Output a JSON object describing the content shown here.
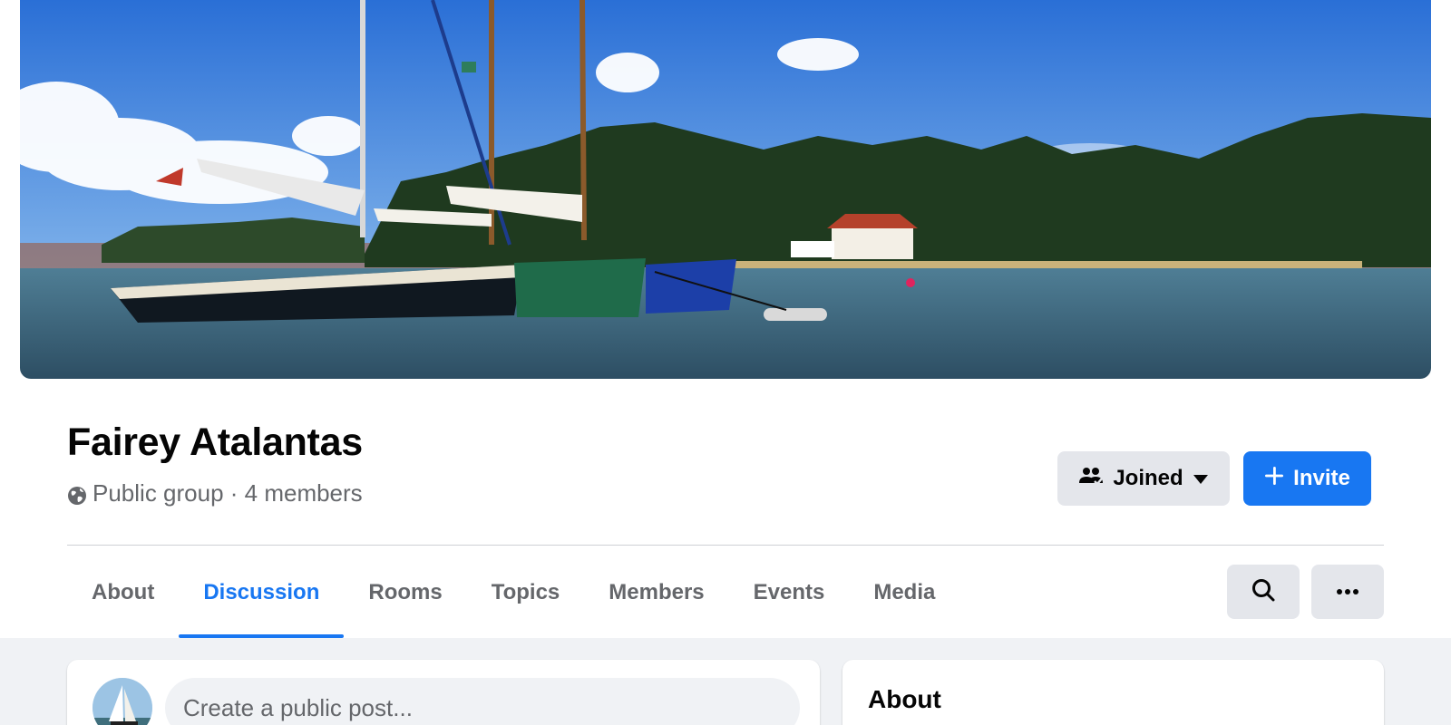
{
  "group": {
    "title": "Fairey Atalantas",
    "meta": "Public group · 4 members"
  },
  "actions": {
    "joined_label": "Joined",
    "invite_label": "Invite"
  },
  "tabs": [
    {
      "label": "About",
      "active": false
    },
    {
      "label": "Discussion",
      "active": true
    },
    {
      "label": "Rooms",
      "active": false
    },
    {
      "label": "Topics",
      "active": false
    },
    {
      "label": "Members",
      "active": false
    },
    {
      "label": "Events",
      "active": false
    },
    {
      "label": "Media",
      "active": false
    }
  ],
  "composer": {
    "placeholder": "Create a public post..."
  },
  "sidebar": {
    "about_heading": "About"
  },
  "icons": {
    "privacy": "globe-icon",
    "joined": "group-members-icon",
    "dropdown": "caret-down-icon",
    "invite": "plus-icon",
    "search": "search-icon",
    "more": "more-horizontal-icon"
  },
  "colors": {
    "accent": "#1877f2",
    "secondary_button": "#e4e6eb",
    "muted_text": "#65676b",
    "page_background": "#f0f2f5"
  }
}
